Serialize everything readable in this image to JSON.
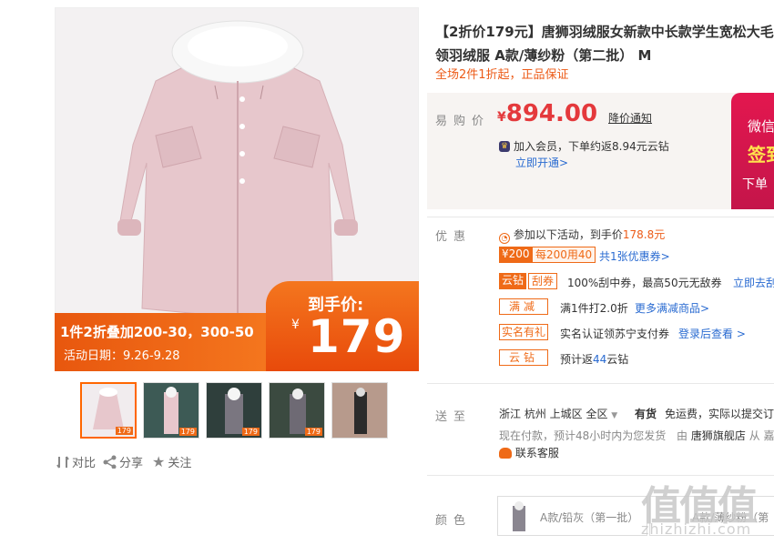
{
  "gallery": {
    "promo_left_line1": "1件2折叠加200-30，300-50",
    "promo_left_line2": "活动日期：9.26-9.28",
    "promo_right_label": "到手价:",
    "promo_right_currency": "¥",
    "promo_right_price": "179",
    "thumbs": [
      {
        "name": "thumb-1",
        "badge": "179",
        "active": true
      },
      {
        "name": "thumb-2",
        "badge": "179",
        "active": false
      },
      {
        "name": "thumb-3",
        "badge": "179",
        "active": false
      },
      {
        "name": "thumb-4",
        "badge": "179",
        "active": false
      },
      {
        "name": "thumb-5",
        "badge": "",
        "active": false
      }
    ],
    "actions": {
      "compare": "对比",
      "share": "分享",
      "follow": "关注"
    }
  },
  "product": {
    "title": "【2折价179元】唐狮羽绒服女新款中长款学生宽松大毛领羽绒服 A款/薄纱粉（第二批） M",
    "subtitle": "全场2件1折起，正品保证"
  },
  "price": {
    "label": "易购价",
    "currency": "¥",
    "value": "894.00",
    "notify": "降价通知",
    "member_text": "加入会员，下单约返8.94元云钻",
    "member_link": "立即开通>"
  },
  "wechat_banner": {
    "line1": "微信",
    "line2": "签到",
    "line3": "下单"
  },
  "promotions": {
    "label": "优惠",
    "intro": "参加以下活动，到手价",
    "intro_price": "178.8元",
    "coupon_tag1": "¥200",
    "coupon_tag2": "每200用40",
    "coupon_link": "共1张优惠券>",
    "yunzuan_tag": "云钻",
    "guaquan_tag": "刮券",
    "guaquan_text": "100%刮中券，最高50元无敌券",
    "guaquan_link": "立即去刮",
    "manjian_tag": "满减",
    "manjian_text": "满1件打2.0折",
    "manjian_link": "更多满减商品>",
    "realname_tag": "实名有礼",
    "realname_text": "实名认证领苏宁支付券",
    "realname_link": "登录后查看 >",
    "yunzuan2_tag": "云钻",
    "yunzuan2_text_pre": "预计返",
    "yunzuan2_num": "44",
    "yunzuan2_text_post": "云钻"
  },
  "delivery": {
    "label": "送至",
    "location": "浙江 杭州 上城区 全区",
    "stock": "有货",
    "shipping": "免运费，实际以提交订",
    "time": "现在付款，预计48小时内为您发货",
    "seller_pre": "由",
    "seller": "唐狮旗舰店",
    "seller_post": "从 嘉",
    "service": "联系客服"
  },
  "color": {
    "label": "颜色",
    "options": [
      "A款/铅灰（第一批）",
      "A款/薄纱粉（第"
    ]
  },
  "watermark": {
    "line1": "值值值",
    "line2": "zhizhizhi.com"
  },
  "colors": {
    "accent": "#e4393c",
    "orange": "#ec5b18",
    "link": "#2a6bd1"
  }
}
